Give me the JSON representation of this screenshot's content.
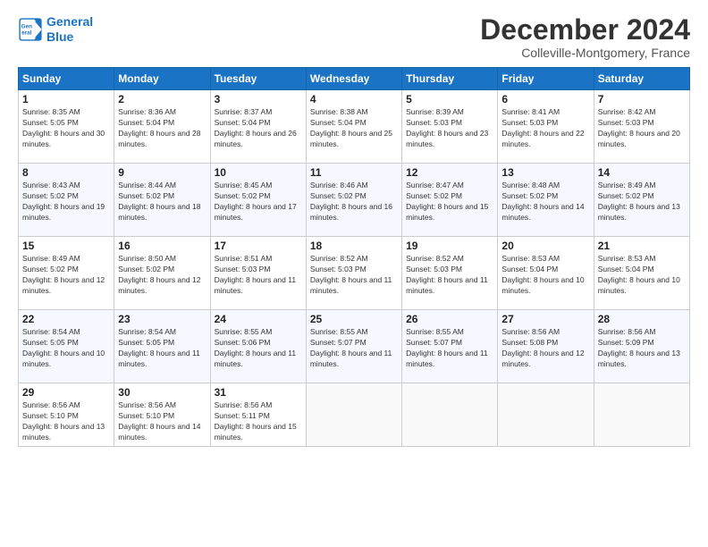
{
  "logo": {
    "line1": "General",
    "line2": "Blue"
  },
  "title": "December 2024",
  "location": "Colleville-Montgomery, France",
  "weekdays": [
    "Sunday",
    "Monday",
    "Tuesday",
    "Wednesday",
    "Thursday",
    "Friday",
    "Saturday"
  ],
  "weeks": [
    [
      {
        "day": "1",
        "sunrise": "8:35 AM",
        "sunset": "5:05 PM",
        "daylight": "8 hours and 30 minutes."
      },
      {
        "day": "2",
        "sunrise": "8:36 AM",
        "sunset": "5:04 PM",
        "daylight": "8 hours and 28 minutes."
      },
      {
        "day": "3",
        "sunrise": "8:37 AM",
        "sunset": "5:04 PM",
        "daylight": "8 hours and 26 minutes."
      },
      {
        "day": "4",
        "sunrise": "8:38 AM",
        "sunset": "5:04 PM",
        "daylight": "8 hours and 25 minutes."
      },
      {
        "day": "5",
        "sunrise": "8:39 AM",
        "sunset": "5:03 PM",
        "daylight": "8 hours and 23 minutes."
      },
      {
        "day": "6",
        "sunrise": "8:41 AM",
        "sunset": "5:03 PM",
        "daylight": "8 hours and 22 minutes."
      },
      {
        "day": "7",
        "sunrise": "8:42 AM",
        "sunset": "5:03 PM",
        "daylight": "8 hours and 20 minutes."
      }
    ],
    [
      {
        "day": "8",
        "sunrise": "8:43 AM",
        "sunset": "5:02 PM",
        "daylight": "8 hours and 19 minutes."
      },
      {
        "day": "9",
        "sunrise": "8:44 AM",
        "sunset": "5:02 PM",
        "daylight": "8 hours and 18 minutes."
      },
      {
        "day": "10",
        "sunrise": "8:45 AM",
        "sunset": "5:02 PM",
        "daylight": "8 hours and 17 minutes."
      },
      {
        "day": "11",
        "sunrise": "8:46 AM",
        "sunset": "5:02 PM",
        "daylight": "8 hours and 16 minutes."
      },
      {
        "day": "12",
        "sunrise": "8:47 AM",
        "sunset": "5:02 PM",
        "daylight": "8 hours and 15 minutes."
      },
      {
        "day": "13",
        "sunrise": "8:48 AM",
        "sunset": "5:02 PM",
        "daylight": "8 hours and 14 minutes."
      },
      {
        "day": "14",
        "sunrise": "8:49 AM",
        "sunset": "5:02 PM",
        "daylight": "8 hours and 13 minutes."
      }
    ],
    [
      {
        "day": "15",
        "sunrise": "8:49 AM",
        "sunset": "5:02 PM",
        "daylight": "8 hours and 12 minutes."
      },
      {
        "day": "16",
        "sunrise": "8:50 AM",
        "sunset": "5:02 PM",
        "daylight": "8 hours and 12 minutes."
      },
      {
        "day": "17",
        "sunrise": "8:51 AM",
        "sunset": "5:03 PM",
        "daylight": "8 hours and 11 minutes."
      },
      {
        "day": "18",
        "sunrise": "8:52 AM",
        "sunset": "5:03 PM",
        "daylight": "8 hours and 11 minutes."
      },
      {
        "day": "19",
        "sunrise": "8:52 AM",
        "sunset": "5:03 PM",
        "daylight": "8 hours and 11 minutes."
      },
      {
        "day": "20",
        "sunrise": "8:53 AM",
        "sunset": "5:04 PM",
        "daylight": "8 hours and 10 minutes."
      },
      {
        "day": "21",
        "sunrise": "8:53 AM",
        "sunset": "5:04 PM",
        "daylight": "8 hours and 10 minutes."
      }
    ],
    [
      {
        "day": "22",
        "sunrise": "8:54 AM",
        "sunset": "5:05 PM",
        "daylight": "8 hours and 10 minutes."
      },
      {
        "day": "23",
        "sunrise": "8:54 AM",
        "sunset": "5:05 PM",
        "daylight": "8 hours and 11 minutes."
      },
      {
        "day": "24",
        "sunrise": "8:55 AM",
        "sunset": "5:06 PM",
        "daylight": "8 hours and 11 minutes."
      },
      {
        "day": "25",
        "sunrise": "8:55 AM",
        "sunset": "5:07 PM",
        "daylight": "8 hours and 11 minutes."
      },
      {
        "day": "26",
        "sunrise": "8:55 AM",
        "sunset": "5:07 PM",
        "daylight": "8 hours and 11 minutes."
      },
      {
        "day": "27",
        "sunrise": "8:56 AM",
        "sunset": "5:08 PM",
        "daylight": "8 hours and 12 minutes."
      },
      {
        "day": "28",
        "sunrise": "8:56 AM",
        "sunset": "5:09 PM",
        "daylight": "8 hours and 13 minutes."
      }
    ],
    [
      {
        "day": "29",
        "sunrise": "8:56 AM",
        "sunset": "5:10 PM",
        "daylight": "8 hours and 13 minutes."
      },
      {
        "day": "30",
        "sunrise": "8:56 AM",
        "sunset": "5:10 PM",
        "daylight": "8 hours and 14 minutes."
      },
      {
        "day": "31",
        "sunrise": "8:56 AM",
        "sunset": "5:11 PM",
        "daylight": "8 hours and 15 minutes."
      },
      null,
      null,
      null,
      null
    ]
  ]
}
